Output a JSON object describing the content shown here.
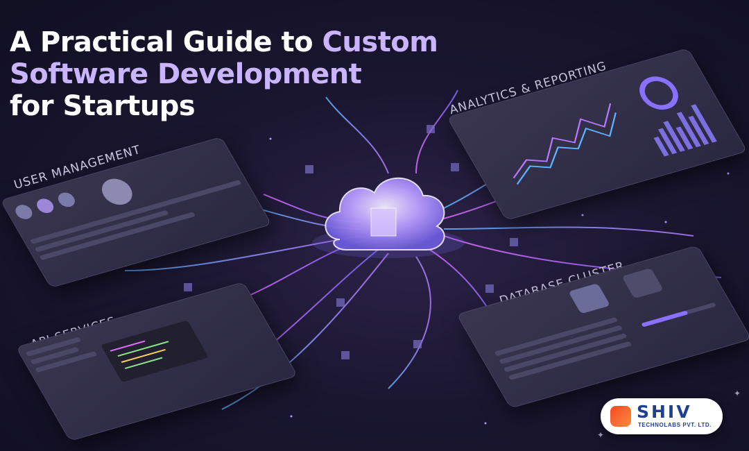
{
  "headline": {
    "line1": "A Practical Guide to ",
    "line1_accent": "Custom",
    "line2_accent": "Software Development",
    "line3": "for Startups"
  },
  "panels": {
    "user_management": "USER MANAGEMENT",
    "analytics": "ANALYTICS & REPORTING",
    "api_services": "API SERVICES",
    "database_cluster": "DATABASE CLUSTER"
  },
  "logo": {
    "brand": "SHIV",
    "subtitle": "TECHNOLABS PVT. LTD."
  },
  "colors": {
    "accent": "#c9b4ff",
    "glow_pink": "#e06cff",
    "glow_blue": "#5fb4ff",
    "brand_blue": "#1f3f8f",
    "brand_orange": "#f04a24"
  }
}
